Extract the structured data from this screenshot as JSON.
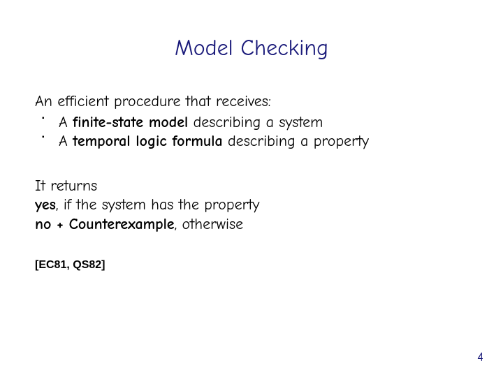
{
  "title": "Model Checking",
  "block1": {
    "intro": "An efficient procedure that receives:",
    "items": [
      {
        "pre": "A ",
        "kw": "finite-state model",
        "post": " describing a system"
      },
      {
        "pre": "A ",
        "kw": "temporal logic formula",
        "post": " describing a property"
      }
    ]
  },
  "block2": {
    "line1": "It returns",
    "line2_pre": "",
    "line2_kw": "yes",
    "line2_post": ", if the system has the property",
    "line3_pre": "",
    "line3_kw": "no + Counterexample",
    "line3_post": ", otherwise"
  },
  "citations": "[EC81, QS82]",
  "page_number": "4"
}
